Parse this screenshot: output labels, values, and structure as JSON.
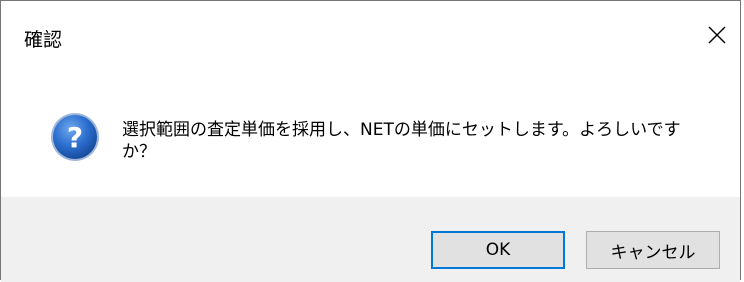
{
  "dialog": {
    "title": "確認",
    "message": "選択範囲の査定単価を採用し、NETの単価にセットします。よろしいですか？",
    "icon": "question-icon",
    "buttons": {
      "ok_label": "OK",
      "cancel_label": "キャンセル"
    },
    "colors": {
      "icon_blue": "#1f5fb4",
      "focus_border": "#0078d7",
      "footer_bg": "#f0f0f0"
    }
  }
}
